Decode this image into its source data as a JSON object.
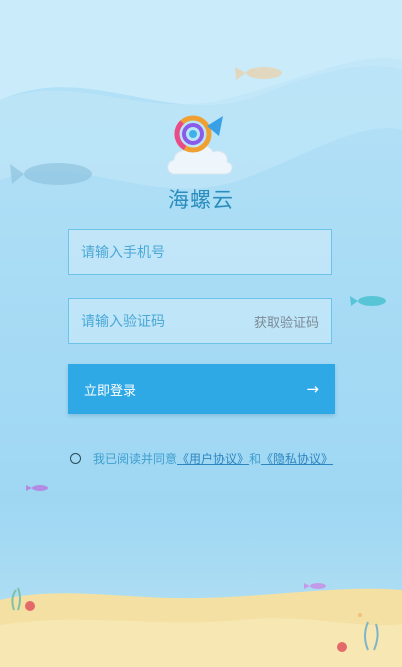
{
  "app": {
    "name": "海螺云"
  },
  "form": {
    "phone_placeholder": "请输入手机号",
    "code_placeholder": "请输入验证码",
    "get_code": "获取验证码",
    "login_label": "立即登录",
    "login_arrow": "→"
  },
  "agreement": {
    "prefix": "我已阅读并同意",
    "user_agreement": "《用户协议》",
    "and": "和",
    "privacy_agreement": "《隐私协议》"
  },
  "colors": {
    "accent": "#2fa9e6",
    "field_border": "#6cc4e8",
    "title": "#2a8dbe"
  }
}
